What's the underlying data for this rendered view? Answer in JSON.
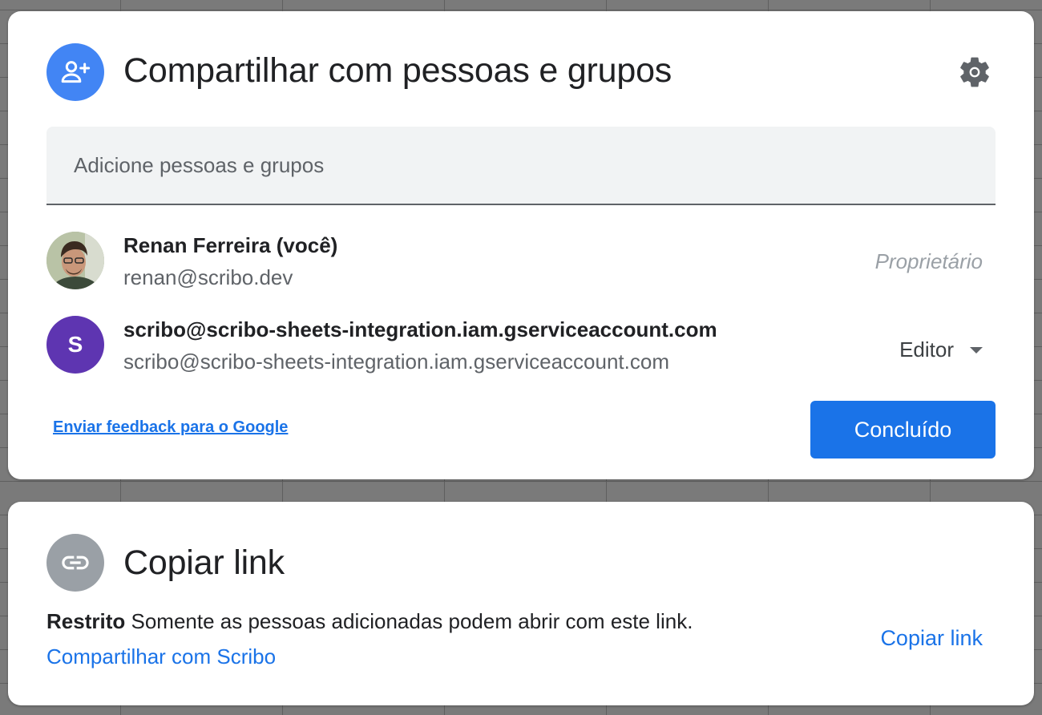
{
  "share_dialog": {
    "title": "Compartilhar com pessoas e grupos",
    "settings_icon": "gear-icon",
    "header_icon": "person-add-icon",
    "add_people": {
      "placeholder": "Adicione pessoas e grupos",
      "value": ""
    },
    "people": [
      {
        "name": "Renan Ferreira (você)",
        "email": "renan@scribo.dev",
        "role": "Proprietário",
        "avatar": "user-photo"
      },
      {
        "name": "scribo@scribo-sheets-integration.iam.gserviceaccount.com",
        "email": "scribo@scribo-sheets-integration.iam.gserviceaccount.com",
        "role": "Editor",
        "avatar_letter": "S",
        "avatar_color": "#5e35b1"
      }
    ],
    "feedback_link": "Enviar feedback para o Google",
    "done_button": "Concluído"
  },
  "link_dialog": {
    "title": "Copiar link",
    "header_icon": "link-icon",
    "access_level": "Restrito",
    "access_description": "Somente as pessoas adicionadas podem abrir com este link.",
    "share_with_link": "Compartilhar com Scribo",
    "copy_button": "Copiar link"
  },
  "colors": {
    "accent": "#1a73e8",
    "share_icon_bg": "#4285f4",
    "link_icon_bg": "#9aa0a6",
    "text_primary": "#202124",
    "text_secondary": "#5f6368"
  }
}
